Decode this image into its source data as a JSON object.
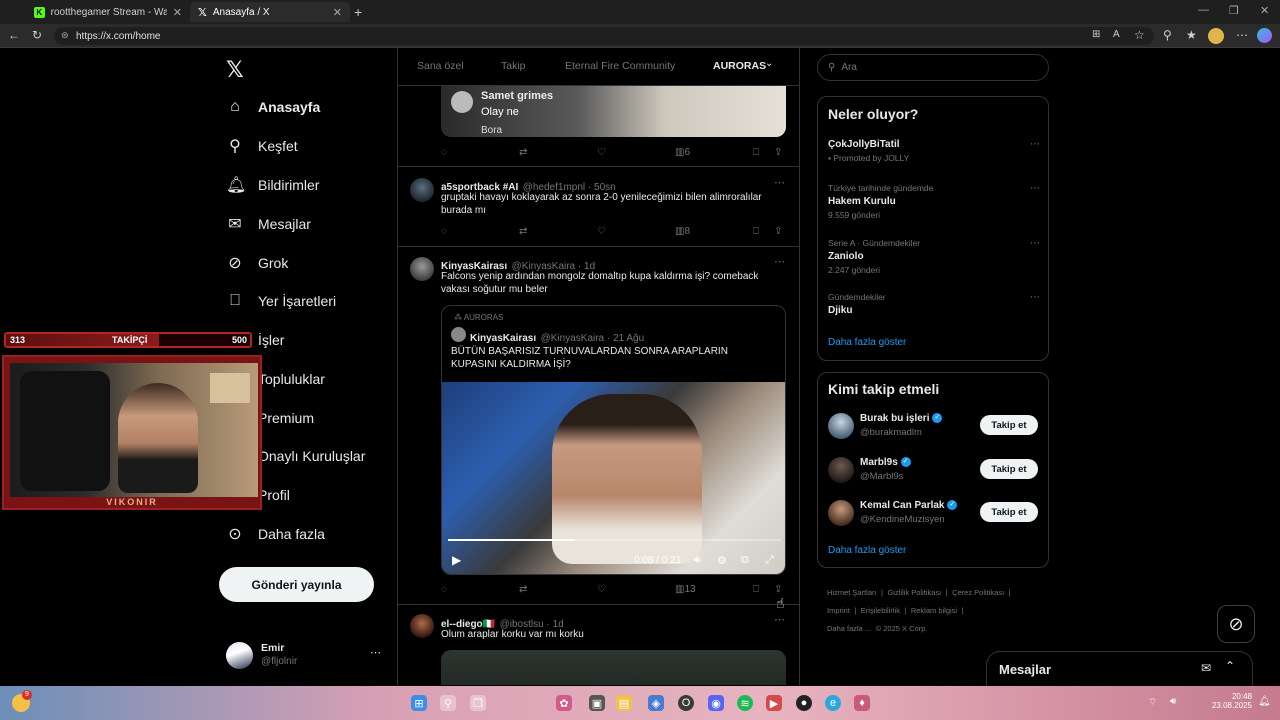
{
  "browser": {
    "tabs": [
      {
        "title": "rootthegamer Stream - Watch Li",
        "active": false
      },
      {
        "title": "Anasayfa / X",
        "active": true
      }
    ],
    "url": "https://x.com/home"
  },
  "nav": {
    "items": [
      {
        "label": "Anasayfa",
        "icon": "home-icon"
      },
      {
        "label": "Keşfet",
        "icon": "search-icon"
      },
      {
        "label": "Bildirimler",
        "icon": "bell-icon"
      },
      {
        "label": "Mesajlar",
        "icon": "mail-icon"
      },
      {
        "label": "Grok",
        "icon": "grok-icon"
      },
      {
        "label": "Yer İşaretleri",
        "icon": "bookmark-icon"
      },
      {
        "label": "İşler",
        "icon": "briefcase-icon"
      },
      {
        "label": "Topluluklar",
        "icon": "people-icon"
      },
      {
        "label": "Premium",
        "icon": "x-icon"
      },
      {
        "label": "Onaylı Kuruluşlar",
        "icon": "lightning-icon"
      },
      {
        "label": "Profil",
        "icon": "user-icon"
      },
      {
        "label": "Daha fazla",
        "icon": "more-circle-icon"
      }
    ],
    "post_button": "Gönderi yayınla",
    "account": {
      "name": "Emir",
      "handle": "@fljolnir"
    }
  },
  "overlay": {
    "followers_count": "313",
    "followers_label": "TAKİPÇİ",
    "followers_goal": "500",
    "webcam_brand": "VIKONIR"
  },
  "timeline": {
    "tabs": [
      "Sana özel",
      "Takip",
      "Eternal Fire Community",
      "AURORAS"
    ],
    "active_tab": "AURORAS",
    "top_media_text": {
      "name": "Samet grimes",
      "msg": "Olay ne",
      "sub": "Bora"
    },
    "tweet0_stats": {
      "views": "6"
    },
    "tweets": [
      {
        "name": "a5sportback #AI",
        "handle": "@hedef1mpnl · 50sn",
        "text": "gruptaki havayı koklayarak az sonra 2-0 yenileceğimizi bilen alimroralılar burada mı",
        "views": "8"
      },
      {
        "name": "KinyasKairası",
        "handle": "@KinyasKaira · 1d",
        "text": "Falcons yenip ardından mongolz domaltıp kupa kaldırma işi? comeback vakası soğutur mu beler",
        "views": "13",
        "quote": {
          "community": "AURORAS",
          "name": "KinyasKairası",
          "handle": "@KinyasKaira · 21 Ağu",
          "text": "BÜTÜN BAŞARISIZ TURNUVALARDAN SONRA ARAPLARIN KUPASINI KALDIRMA İŞİ?",
          "video_time": "0:08 / 0:21",
          "video_progress": 0.38
        }
      },
      {
        "name": "el--diego🇮🇹",
        "handle": "@ibostlsu · 1d",
        "text": "Olum araplar korku var mı korku"
      }
    ]
  },
  "sidebar": {
    "search_placeholder": "Ara",
    "trends_title": "Neler oluyor?",
    "trends": [
      {
        "meta": "",
        "name": "ÇokJollyBiTatil",
        "sub": "Promoted by JOLLY"
      },
      {
        "meta": "Türkiye tarihinde gündemde",
        "name": "Hakem Kurulu",
        "sub": "9.559 gönderi"
      },
      {
        "meta": "Serie A · Gündemdekiler",
        "name": "Zaniolo",
        "sub": "2.247 gönderi"
      },
      {
        "meta": "Gündemdekiler",
        "name": "Djiku",
        "sub": ""
      }
    ],
    "trends_more": "Daha fazla göster",
    "follow_title": "Kimi takip etmeli",
    "follow": [
      {
        "name": "Burak bu işleri",
        "handle": "@burakmadlm"
      },
      {
        "name": "Marbl9s",
        "handle": "@Marbl9s"
      },
      {
        "name": "Kemal Can Parlak",
        "handle": "@KendineMuzisyen"
      }
    ],
    "follow_button": "Takip et",
    "follow_more": "Daha fazla göster",
    "footer": [
      "Hizmet Şartları",
      "Gizlilik Politikası",
      "Çerez Politikası",
      "Imprint",
      "Erişilebilirlik",
      "Reklam bilgisi",
      "Daha fazla ...",
      "© 2025 X Corp."
    ]
  },
  "messages_drawer": {
    "title": "Mesajlar"
  },
  "taskbar": {
    "time": "20:48",
    "date": "23.08.2025",
    "badge": "9"
  }
}
